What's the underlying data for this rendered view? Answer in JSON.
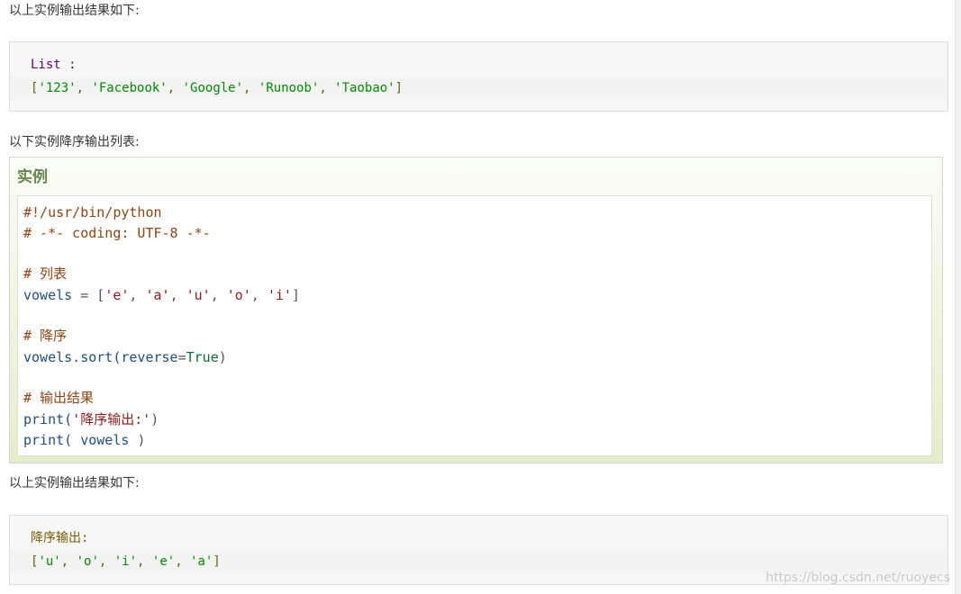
{
  "intro_1": "以上实例输出结果如下:",
  "output_1": {
    "line1": "List :",
    "line2": {
      "open": "[",
      "items": [
        "'123'",
        "'Facebook'",
        "'Google'",
        "'Runoob'",
        "'Taobao'"
      ],
      "sep": ", ",
      "close": "]"
    }
  },
  "intro_2": "以下实例降序输出列表:",
  "example": {
    "title": "实例",
    "code": {
      "shebang": "#!/usr/bin/python",
      "coding": "# -*- coding: UTF-8 -*-",
      "comment_list": "# 列表",
      "vowels_name": "vowels",
      "vowels_eq": " = [",
      "v1": "'e'",
      "v2": "'a'",
      "v3": "'u'",
      "v4": "'o'",
      "v5": "'i'",
      "comma": ", ",
      "close_bracket": "]",
      "comment_desc": "# 降序",
      "sort_call": "vowels.sort(",
      "reverse_kw": "reverse",
      "eq": "=",
      "true_const": "True",
      "close_paren": ")",
      "comment_output": "# 输出结果",
      "print1_fn": "print(",
      "print1_str": "'降序输出:'",
      "print1_close": ")",
      "print2_fn": "print(",
      "print2_arg": " vowels ",
      "print2_close": ")"
    }
  },
  "intro_3": "以上实例输出结果如下:",
  "output_2": {
    "line1": "降序输出:",
    "line2": {
      "open": "[",
      "items": [
        "'u'",
        "'o'",
        "'i'",
        "'e'",
        "'a'"
      ],
      "sep": ", ",
      "close": "]"
    }
  },
  "watermark": "https://blog.csdn.net/ruoyecs"
}
